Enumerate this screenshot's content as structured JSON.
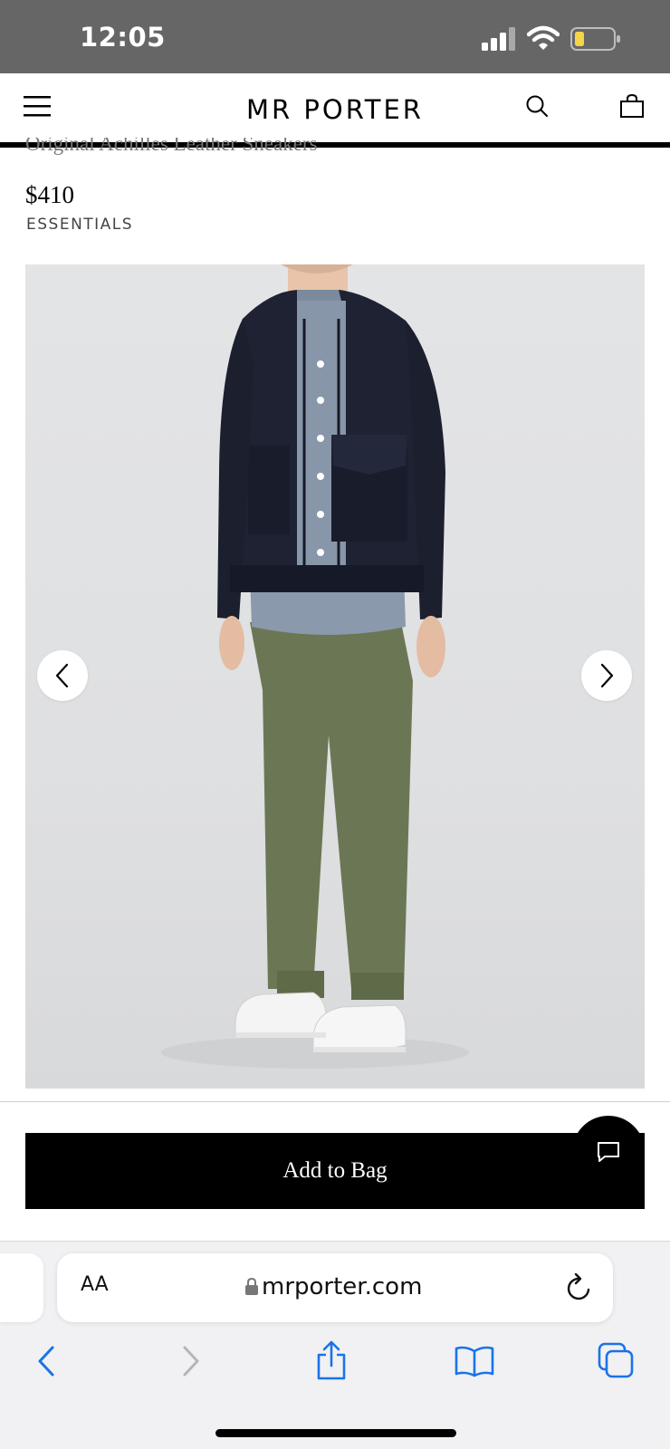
{
  "status_bar": {
    "time": "12:05",
    "battery_color": "#f5d547"
  },
  "header": {
    "brand": "MR PORTER",
    "icons": [
      "menu-icon",
      "search-icon",
      "bag-icon"
    ]
  },
  "product": {
    "name": "Original Achilles Leather Sneakers",
    "price": "$410",
    "collection": "ESSENTIALS",
    "gallery": {
      "prev_icon": "chevron-left-icon",
      "next_icon": "chevron-right-icon"
    }
  },
  "actions": {
    "add_to_bag": "Add to Bag",
    "chat_icon": "chat-icon"
  },
  "browser": {
    "text_size_label": "AA",
    "url": "mrporter.com",
    "accent_color": "#1a73e8",
    "toolbar_icons": [
      "back-icon",
      "forward-icon",
      "share-icon",
      "bookmarks-icon",
      "tabs-icon"
    ]
  }
}
